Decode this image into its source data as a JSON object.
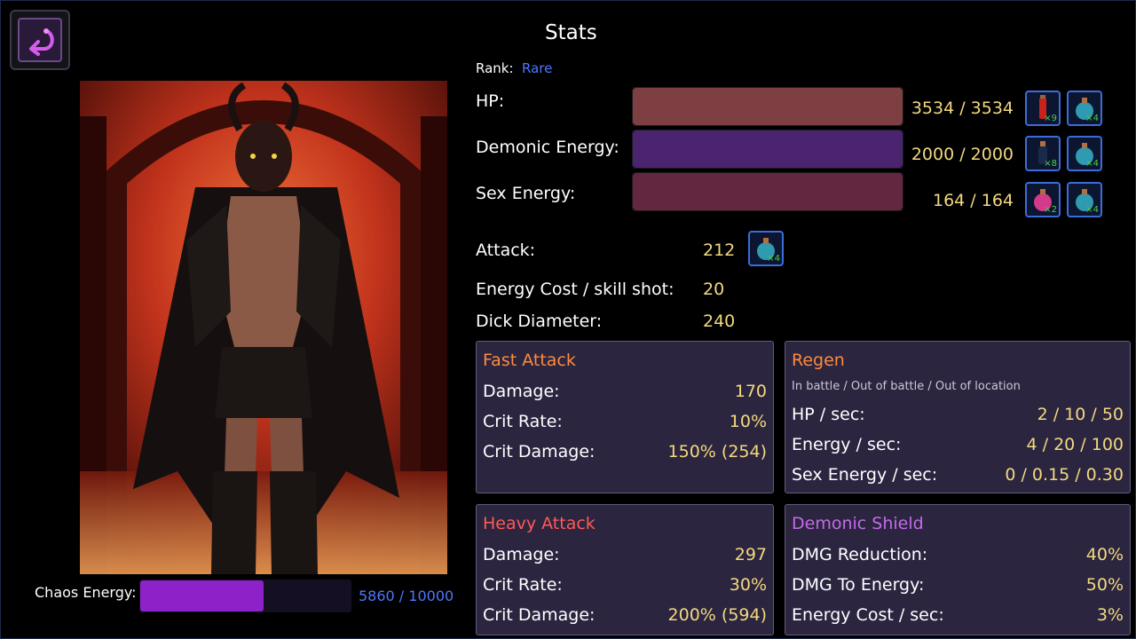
{
  "colors": {
    "hp_bar": "#7d3f42",
    "energy_bar": "#4b2470",
    "sex_bar": "#63273f",
    "chaos_fill": "#8c22c7",
    "value_yellow": "#f3d97f",
    "rank_blue": "#4d78ff",
    "fast_attack_title": "#ff8a3d",
    "heavy_attack_title": "#ff5a55",
    "regen_title": "#ff8a3d",
    "shield_title": "#c46bea"
  },
  "header": {
    "title": "Stats"
  },
  "rank": {
    "label": "Rank:",
    "value": "Rare"
  },
  "chaos": {
    "label": "Chaos Energy:",
    "value": "5860 / 10000",
    "current": 5860,
    "max": 10000
  },
  "bars": {
    "hp": {
      "label": "HP:",
      "value": "3534 / 3534",
      "fill": 1.0,
      "items": [
        {
          "icon": "red-potion-icon",
          "count": "×9"
        },
        {
          "icon": "blue-potion-icon",
          "count": "×4"
        }
      ]
    },
    "energy": {
      "label": "Demonic Energy:",
      "value": "2000 / 2000",
      "fill": 1.0,
      "items": [
        {
          "icon": "dark-potion-icon",
          "count": "×8"
        },
        {
          "icon": "blue-potion-icon",
          "count": "×4"
        }
      ]
    },
    "sex": {
      "label": "Sex Energy:",
      "value": "164 / 164",
      "fill": 1.0,
      "items": [
        {
          "icon": "pink-potion-icon",
          "count": "×2"
        },
        {
          "icon": "blue-potion-icon",
          "count": "×4"
        }
      ]
    }
  },
  "attack": {
    "label": "Attack:",
    "value": "212",
    "item": {
      "icon": "blue-potion-icon",
      "count": "×4"
    }
  },
  "energy_cost": {
    "label": "Energy Cost / skill shot:",
    "value": "20"
  },
  "dick": {
    "label": "Dick Diameter:",
    "value": "240"
  },
  "fast_attack": {
    "title": "Fast Attack",
    "rows": [
      {
        "label": "Damage:",
        "value": "170"
      },
      {
        "label": "Crit Rate:",
        "value": "10%"
      },
      {
        "label": "Crit Damage:",
        "value": "150% (254)"
      }
    ]
  },
  "regen": {
    "title": "Regen",
    "subtitle": "In battle / Out of battle / Out of location",
    "rows": [
      {
        "label": "HP / sec:",
        "value": "2 / 10 / 50"
      },
      {
        "label": "Energy / sec:",
        "value": "4 / 20 / 100"
      },
      {
        "label": "Sex Energy / sec:",
        "value": "0 / 0.15 / 0.30"
      }
    ]
  },
  "heavy_attack": {
    "title": "Heavy Attack",
    "rows": [
      {
        "label": "Damage:",
        "value": "297"
      },
      {
        "label": "Crit Rate:",
        "value": "30%"
      },
      {
        "label": "Crit Damage:",
        "value": "200% (594)"
      }
    ]
  },
  "shield": {
    "title": "Demonic Shield",
    "rows": [
      {
        "label": "DMG Reduction:",
        "value": "40%"
      },
      {
        "label": "DMG To Energy:",
        "value": "50%"
      },
      {
        "label": "Energy Cost / sec:",
        "value": "3%"
      }
    ]
  }
}
